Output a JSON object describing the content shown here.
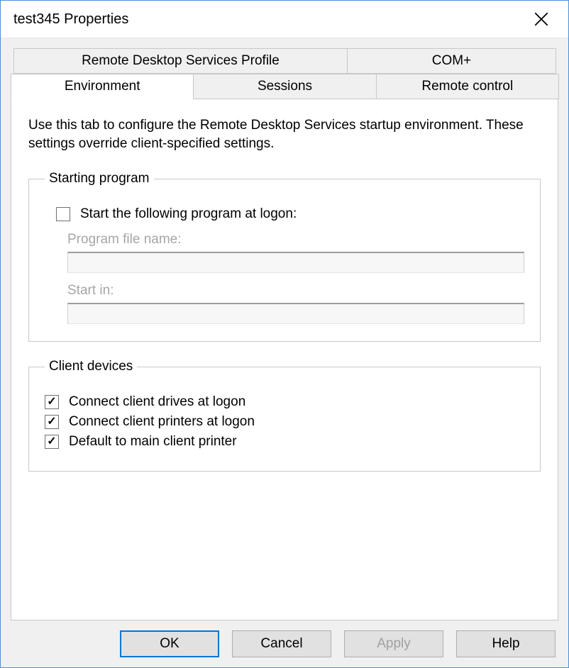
{
  "window": {
    "title": "test345 Properties"
  },
  "tabs": {
    "row1": [
      {
        "label": "Remote Desktop Services Profile"
      },
      {
        "label": "COM+"
      }
    ],
    "row2": [
      {
        "label": "Environment"
      },
      {
        "label": "Sessions"
      },
      {
        "label": "Remote control"
      }
    ],
    "active": "Environment"
  },
  "description": "Use this tab to configure the Remote Desktop Services startup environment. These settings override client-specified settings.",
  "starting_program": {
    "legend": "Starting program",
    "start_checkbox_label": "Start the following program at logon:",
    "start_checked": false,
    "program_file_label": "Program file name:",
    "program_file_value": "",
    "start_in_label": "Start in:",
    "start_in_value": ""
  },
  "client_devices": {
    "legend": "Client devices",
    "items": [
      {
        "label": "Connect client drives at logon",
        "checked": true
      },
      {
        "label": "Connect client printers at logon",
        "checked": true
      },
      {
        "label": "Default to main client printer",
        "checked": true
      }
    ]
  },
  "buttons": {
    "ok": "OK",
    "cancel": "Cancel",
    "apply": "Apply",
    "help": "Help"
  }
}
